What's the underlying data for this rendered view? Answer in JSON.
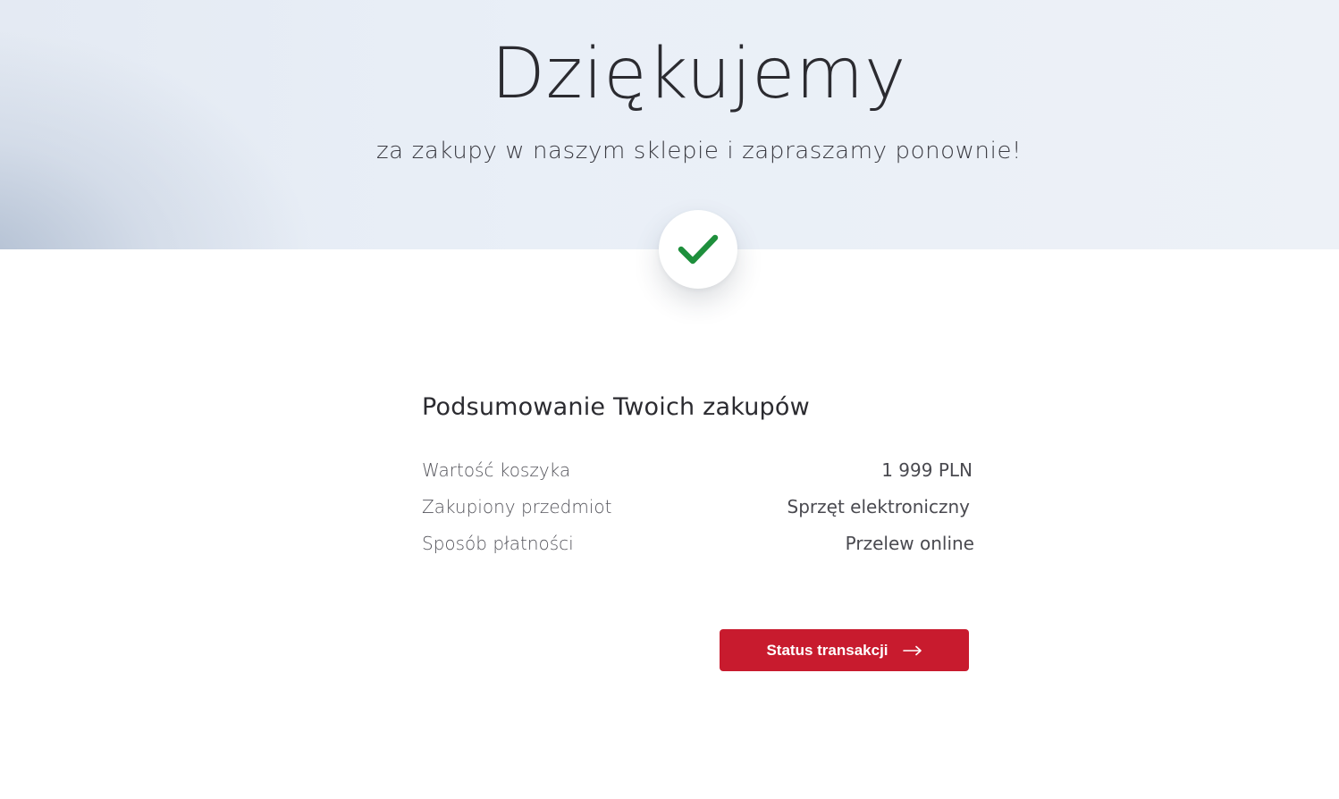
{
  "hero": {
    "title": "Dziękujemy",
    "subtitle": "za zakupy w naszym sklepie i zapraszamy ponownie!"
  },
  "status_icon": {
    "name": "checkmark-icon",
    "color": "#1e8f3c"
  },
  "summary": {
    "title": "Podsumowanie Twoich zakupów",
    "rows": [
      {
        "label": "Wartość koszyka",
        "value": "1 999 PLN"
      },
      {
        "label": "Zakupiony przedmiot",
        "value": "Sprzęt elektroniczny"
      },
      {
        "label": "Sposób płatności",
        "value": "Przelew online"
      }
    ]
  },
  "action": {
    "label": "Status transakcji",
    "icon": "arrow-right-icon",
    "color": "#c81b2e"
  }
}
